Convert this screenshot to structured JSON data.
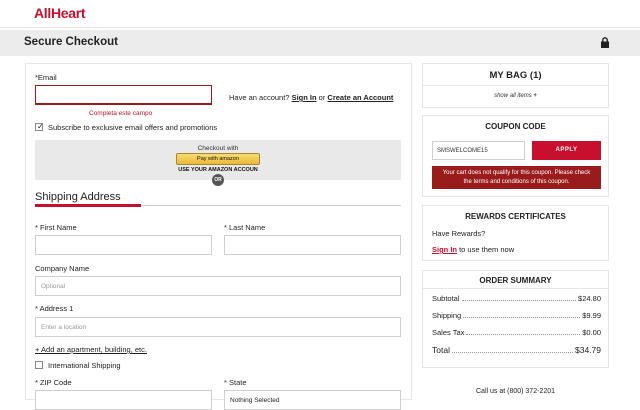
{
  "header": {
    "logo": "AllHeart"
  },
  "checkout_bar": {
    "title": "Secure Checkout",
    "icon": "lock-icon"
  },
  "form": {
    "email_label": "*Email",
    "email_value": "",
    "email_error": "Completa este campo",
    "account_prompt": "Have an account?",
    "sign_in": "Sign In",
    "or": "or",
    "create_account": "Create an Account",
    "subscribe_label": "Subscribe to exclusive email offers and promotions",
    "subscribe_checked": true,
    "amazon": {
      "title": "Checkout with",
      "button_label": "Pay with amazon",
      "caption": "USE YOUR AMAZON ACCOUN",
      "or_label": "OR"
    },
    "shipping_title": "Shipping Address",
    "first_name_label": "* First Name",
    "last_name_label": "* Last Name",
    "company_label": "Company Name",
    "company_placeholder": "Optional",
    "address1_label": "* Address 1",
    "address1_placeholder": "Enter a location",
    "add_apartment": "+ Add an apartment, building, etc.",
    "international_label": "International Shipping",
    "international_checked": false,
    "zip_label": "* ZIP Code",
    "state_label": "* State",
    "state_value": "Nothing Selected"
  },
  "bag": {
    "title": "MY BAG (1)",
    "show_all": "show all items",
    "show_all_icon": "plus-icon"
  },
  "coupon": {
    "title": "COUPON CODE",
    "code_value": "SMSWELCOME15",
    "apply_label": "APPLY",
    "error": "Your cart does not qualify for this coupon. Please check the terms and conditions of this coupon."
  },
  "rewards": {
    "title": "REWARDS CERTIFICATES",
    "prompt": "Have Rewards?",
    "sign_in": "Sign In",
    "sign_in_suffix": "to use them now"
  },
  "summary": {
    "title": "ORDER SUMMARY",
    "rows": [
      {
        "label": "Subtotal",
        "value": "$24.80"
      },
      {
        "label": "Shipping",
        "value": "$9.99"
      },
      {
        "label": "Sales Tax",
        "value": "$0.00"
      }
    ],
    "total_label": "Total",
    "total_value": "$34.79"
  },
  "footer": {
    "call_us": "Call us at (800) 372-2201"
  },
  "colors": {
    "accent": "#c8102e",
    "error_bg": "#9a1b1b",
    "bar_bg": "#ececec"
  }
}
